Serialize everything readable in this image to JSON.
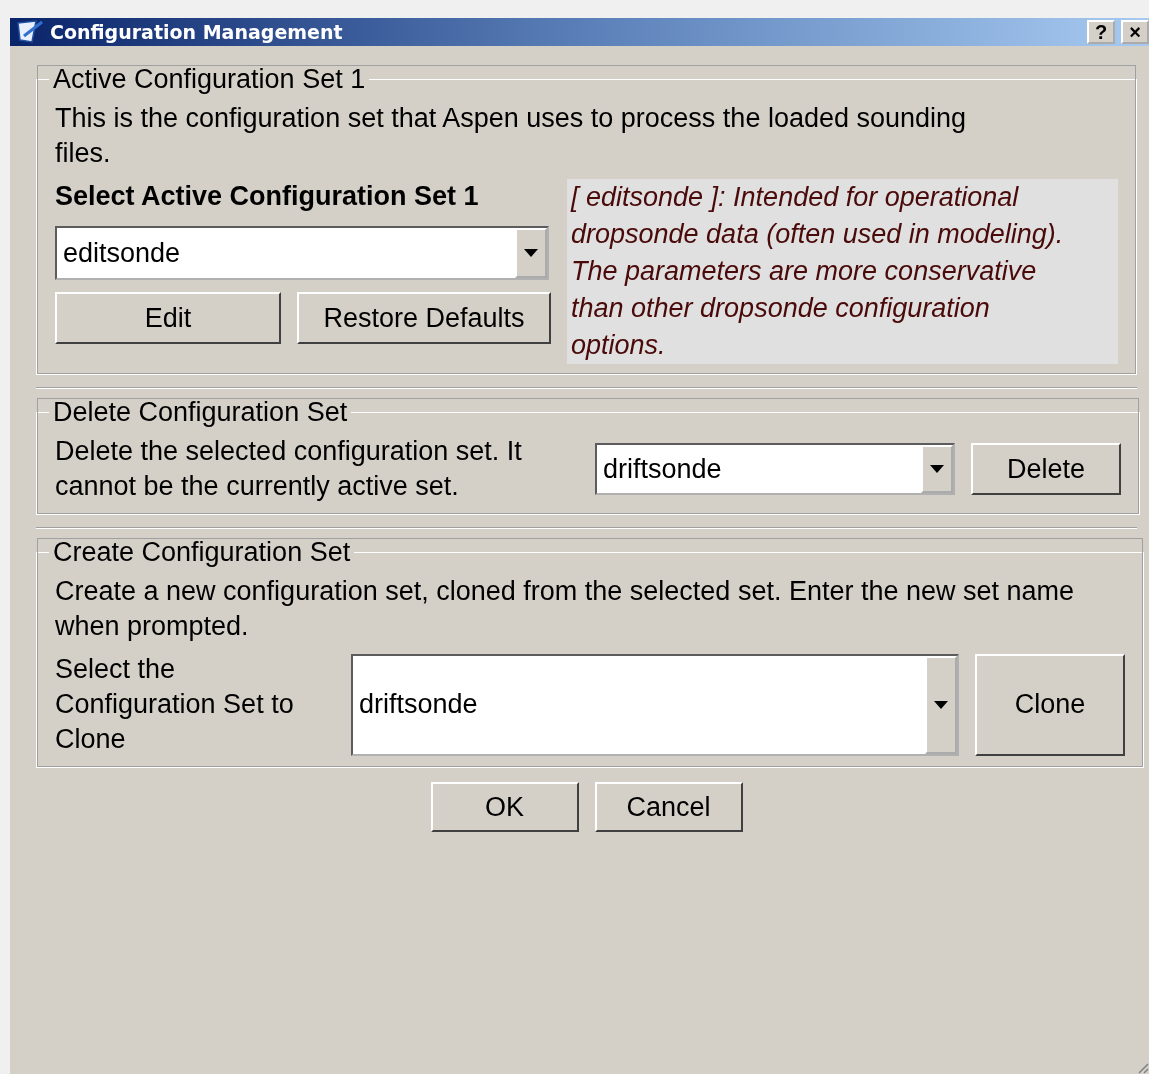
{
  "window": {
    "title": "Configuration Management",
    "buttons": [
      "?",
      "×"
    ]
  },
  "active_set": {
    "title": "Active Configuration Set 1",
    "description": "This is the configuration set that Aspen uses to process the loaded sounding files.",
    "select_label": "Select Active Configuration Set 1",
    "dropdown": {
      "value": "editsonde"
    },
    "buttons": [
      "Edit",
      "Restore Defaults"
    ],
    "info": "[ editsonde ]:  Intended for operational dropsonde data (often used in modeling). The parameters are more conservative than other dropsonde configuration options."
  },
  "delete_set": {
    "title": "Delete Configuration Set",
    "description": "Delete the selected configuration set. It cannot be the currently active set.",
    "dropdown": {
      "value": "driftsonde"
    },
    "button": "Delete"
  },
  "create_set": {
    "title": "Create Configuration Set",
    "description": "Create a new configuration set, cloned from the selected set. Enter the new set name when prompted.",
    "select_label": "Select the Configuration Set to Clone",
    "dropdown": {
      "value": "driftsonde"
    },
    "button": "Clone"
  },
  "footer_buttons": [
    "OK",
    "Cancel"
  ]
}
